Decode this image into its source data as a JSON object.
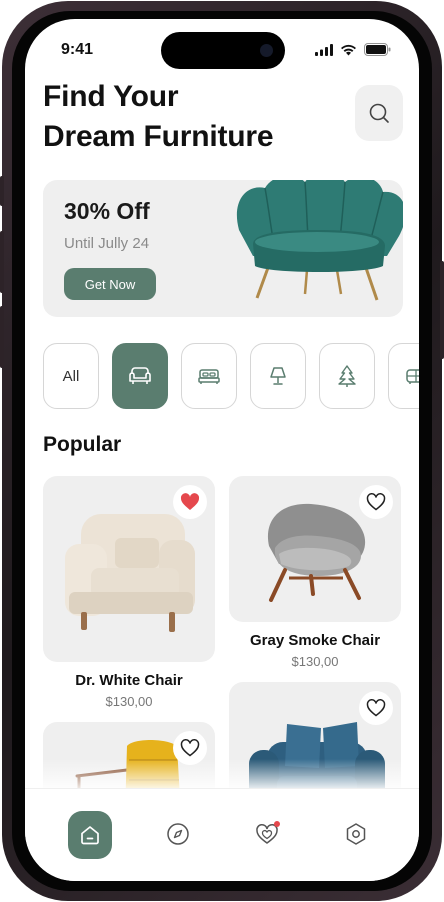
{
  "status": {
    "time": "9:41"
  },
  "header": {
    "title_line1": "Find Your",
    "title_line2": "Dream Furniture"
  },
  "promo": {
    "title": "30% Off",
    "subtitle": "Until Jully 24",
    "button": "Get Now"
  },
  "categories": {
    "all_label": "All",
    "items": [
      {
        "icon": "all",
        "active": false
      },
      {
        "icon": "sofa-icon",
        "active": true
      },
      {
        "icon": "bed-icon",
        "active": false
      },
      {
        "icon": "lamp-icon",
        "active": false
      },
      {
        "icon": "tree-icon",
        "active": false
      },
      {
        "icon": "cabinet-icon",
        "active": false
      }
    ]
  },
  "section": {
    "popular": "Popular"
  },
  "products": [
    {
      "name": "Dr. White Chair",
      "price": "$130,00",
      "favorite": true
    },
    {
      "name": "Gray Smoke Chair",
      "price": "$130,00",
      "favorite": false
    },
    {
      "name": "",
      "price": "",
      "favorite": false
    },
    {
      "name": "",
      "price": "",
      "favorite": false
    }
  ],
  "colors": {
    "accent": "#5a7d6f",
    "favorite": "#e5484d",
    "card_bg": "#efefef"
  },
  "nav": [
    "home-icon",
    "compass-icon",
    "favorites-icon",
    "settings-icon"
  ]
}
